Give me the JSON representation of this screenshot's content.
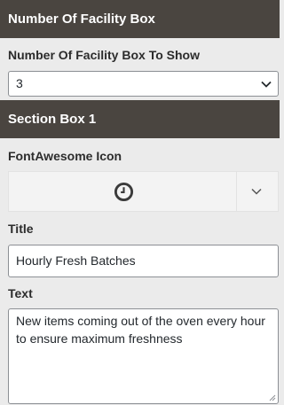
{
  "facility": {
    "header": "Number Of Facility Box",
    "count_label": "Number Of Facility Box To Show",
    "count_value": "3"
  },
  "section_box": {
    "header": "Section Box 1",
    "icon_label": "FontAwesome Icon",
    "icon_name": "clock-icon",
    "title_label": "Title",
    "title_value": "Hourly Fresh Batches",
    "text_label": "Text",
    "text_value": "New items coming out of the oven every hour to ensure maximum freshness"
  },
  "colors": {
    "header_bg": "#4a4540",
    "panel_bg": "#ebebeb",
    "field_border": "#8c8f94"
  }
}
